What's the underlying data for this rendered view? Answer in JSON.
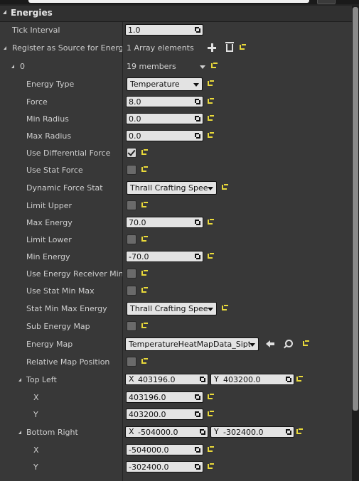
{
  "section": {
    "title": "Energies"
  },
  "rows": {
    "tick_interval": {
      "label": "Tick Interval",
      "value": "1.0"
    },
    "register": {
      "label": "Register as Source for Energies",
      "value": "1 Array elements"
    },
    "element0": {
      "label": "0",
      "value": "19 members"
    },
    "energy_type": {
      "label": "Energy Type",
      "value": "Temperature"
    },
    "force": {
      "label": "Force",
      "value": "8.0"
    },
    "min_radius": {
      "label": "Min Radius",
      "value": "0.0"
    },
    "max_radius": {
      "label": "Max Radius",
      "value": "0.0"
    },
    "use_diff_force": {
      "label": "Use Differential Force",
      "checked": true
    },
    "use_stat_force": {
      "label": "Use Stat Force",
      "checked": false
    },
    "dynamic_force_stat": {
      "label": "Dynamic Force Stat",
      "value": "Thrall Crafting Speed"
    },
    "limit_upper": {
      "label": "Limit Upper",
      "checked": false
    },
    "max_energy": {
      "label": "Max Energy",
      "value": "70.0"
    },
    "limit_lower": {
      "label": "Limit Lower",
      "checked": false
    },
    "min_energy": {
      "label": "Min Energy",
      "value": "-70.0"
    },
    "use_energy_receiver": {
      "label": "Use Energy Receiver Min Max",
      "checked": false
    },
    "use_stat_min_max": {
      "label": "Use Stat Min Max",
      "checked": false
    },
    "stat_min_max_energy": {
      "label": "Stat Min Max Energy",
      "value": "Thrall Crafting Speed"
    },
    "sub_energy_map": {
      "label": "Sub Energy Map",
      "checked": false
    },
    "energy_map": {
      "label": "Energy Map",
      "value": "TemperatureHeatMapData_Siptah"
    },
    "relative_map_position": {
      "label": "Relative Map Position",
      "checked": false
    },
    "top_left": {
      "label": "Top Left",
      "x_label": "X",
      "x_value": "403196.0",
      "y_label": "Y",
      "y_value": "403200.0"
    },
    "top_left_x": {
      "label": "X",
      "value": "403196.0"
    },
    "top_left_y": {
      "label": "Y",
      "value": "403200.0"
    },
    "bottom_right": {
      "label": "Bottom Right",
      "x_label": "X",
      "x_value": "-504000.0",
      "y_label": "Y",
      "y_value": "-302400.0"
    },
    "bottom_right_x": {
      "label": "X",
      "value": "-504000.0"
    },
    "bottom_right_y": {
      "label": "Y",
      "value": "-302400.0"
    }
  }
}
